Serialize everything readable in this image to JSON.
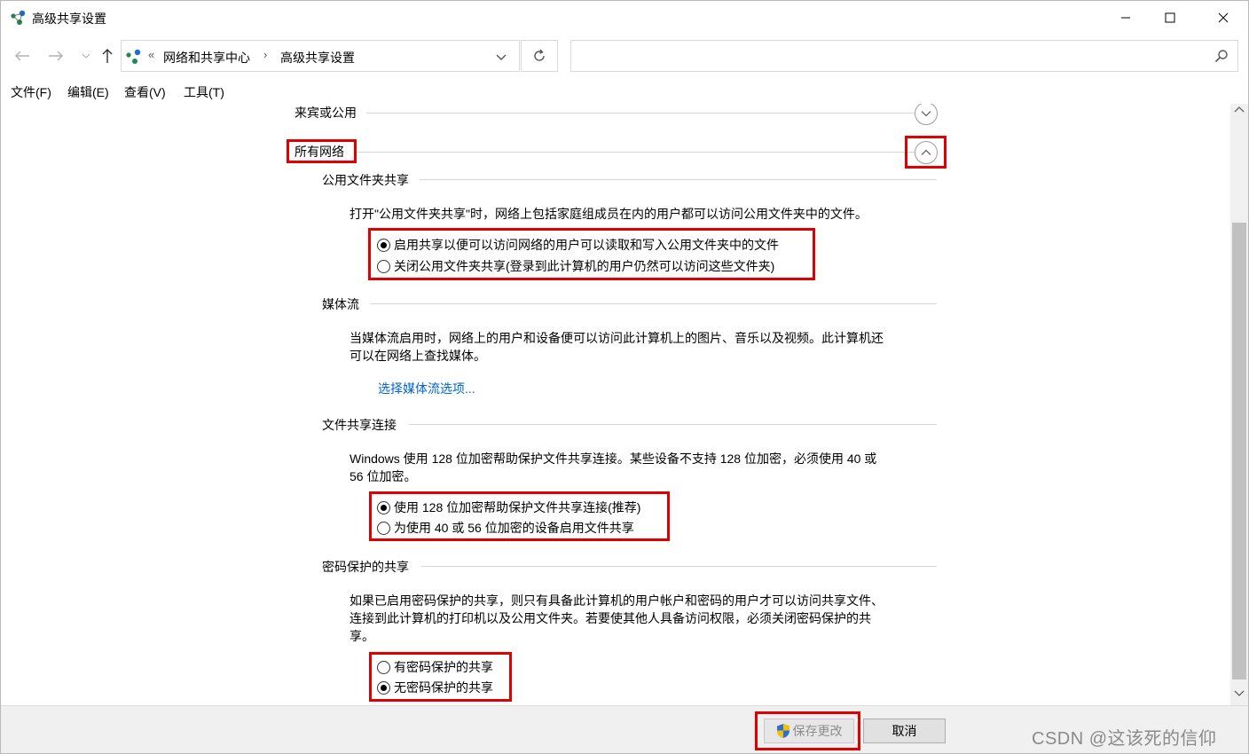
{
  "window": {
    "title": "高级共享设置"
  },
  "address_bar": {
    "overflow_chevron": "«",
    "breadcrumbs": [
      "网络和共享中心",
      "高级共享设置"
    ],
    "separator": "›",
    "search_placeholder": ""
  },
  "menu": {
    "items": [
      "文件(F)",
      "编辑(E)",
      "查看(V)",
      "工具(T)"
    ]
  },
  "profiles": {
    "guest_public": "来宾或公用",
    "all_networks": "所有网络"
  },
  "public_folder": {
    "heading": "公用文件夹共享",
    "description": "打开\"公用文件夹共享\"时，网络上包括家庭组成员在内的用户都可以访问公用文件夹中的文件。",
    "options": [
      {
        "label": "启用共享以便可以访问网络的用户可以读取和写入公用文件夹中的文件",
        "checked": true
      },
      {
        "label": "关闭公用文件夹共享(登录到此计算机的用户仍然可以访问这些文件夹)",
        "checked": false
      }
    ]
  },
  "media_streaming": {
    "heading": "媒体流",
    "description_line1": "当媒体流启用时，网络上的用户和设备便可以访问此计算机上的图片、音乐以及视频。此计算机还",
    "description_line2": "可以在网络上查找媒体。",
    "link": "选择媒体流选项..."
  },
  "file_sharing": {
    "heading": "文件共享连接",
    "description_line1": "Windows 使用 128 位加密帮助保护文件共享连接。某些设备不支持 128 位加密，必须使用 40 或",
    "description_line2": "56 位加密。",
    "options": [
      {
        "label": "使用 128 位加密帮助保护文件共享连接(推荐)",
        "checked": true
      },
      {
        "label": "为使用 40 或 56 位加密的设备启用文件共享",
        "checked": false
      }
    ]
  },
  "password_sharing": {
    "heading": "密码保护的共享",
    "description_line1": "如果已启用密码保护的共享，则只有具备此计算机的用户帐户和密码的用户才可以访问共享文件、",
    "description_line2": "连接到此计算机的打印机以及公用文件夹。若要使其他人具备访问权限，必须关闭密码保护的共",
    "description_line3": "享。",
    "options": [
      {
        "label": "有密码保护的共享",
        "checked": false
      },
      {
        "label": "无密码保护的共享",
        "checked": true
      }
    ]
  },
  "footer": {
    "save_label": "保存更改",
    "cancel_label": "取消",
    "watermark": "CSDN @这该死的信仰"
  },
  "colors": {
    "highlight": "#e00000",
    "link": "#0066cc",
    "shield_blue": "#2b6fd6",
    "shield_yellow": "#f2c200"
  }
}
